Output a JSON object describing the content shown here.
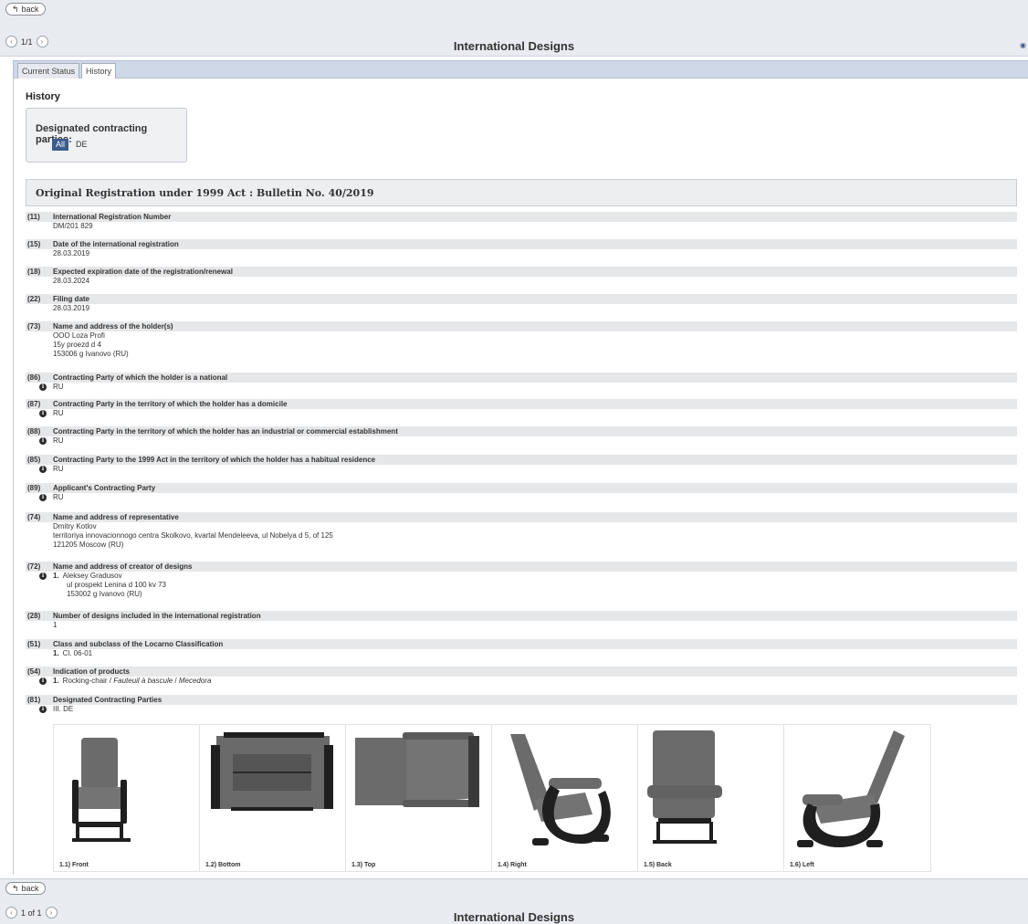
{
  "nav": {
    "back_label": "back",
    "pager_top": "1/1",
    "pager_bottom": "1 of 1",
    "title": "International Designs"
  },
  "tabs": [
    {
      "label": "Current Status",
      "active": false
    },
    {
      "label": "History",
      "active": true
    }
  ],
  "history": {
    "heading": "History",
    "filter_label": "Designated contracting parties:",
    "filter_options": [
      "All",
      "DE"
    ],
    "filter_selected": "All"
  },
  "section": {
    "title": "Original Registration under 1999 Act : Bulletin No. 40/2019"
  },
  "fields": {
    "f11": {
      "code": "(11)",
      "label": "International Registration Number",
      "lines": [
        "DM/201 829"
      ]
    },
    "f15": {
      "code": "(15)",
      "label": "Date of the international registration",
      "lines": [
        "28.03.2019"
      ]
    },
    "f18": {
      "code": "(18)",
      "label": "Expected expiration date of the registration/renewal",
      "lines": [
        "28.03.2024"
      ]
    },
    "f22": {
      "code": "(22)",
      "label": "Filing date",
      "lines": [
        "28.03.2019"
      ]
    },
    "f73": {
      "code": "(73)",
      "label": "Name and address of the holder(s)",
      "lines": [
        "OOO Loza Profi",
        "15y proezd d 4",
        "153006 g Ivanovo (RU)"
      ]
    },
    "f86": {
      "code": "(86)",
      "label": "Contracting Party of which the holder is a national",
      "lines": [
        "RU"
      ]
    },
    "f87": {
      "code": "(87)",
      "label": "Contracting Party in the territory of which the holder has a domicile",
      "lines": [
        "RU"
      ]
    },
    "f88": {
      "code": "(88)",
      "label": "Contracting Party in the territory of which the holder has an industrial or commercial establishment",
      "lines": [
        "RU"
      ]
    },
    "f85": {
      "code": "(85)",
      "label": "Contracting Party to the 1999 Act in the territory of which the holder has a habitual residence",
      "lines": [
        "RU"
      ]
    },
    "f89": {
      "code": "(89)",
      "label": "Applicant's Contracting Party",
      "lines": [
        "RU"
      ]
    },
    "f74": {
      "code": "(74)",
      "label": "Name and address of representative",
      "lines": [
        "Dmitry Kotlov",
        "territoriya innovacionnogo centra Skolkovo, kvartal Mendeleeva, ul Nobelya d 5, of 125",
        "121205 Moscow (RU)"
      ]
    },
    "f72": {
      "code": "(72)",
      "label": "Name and address of creator of designs",
      "num": "1.",
      "lines": [
        "Aleksey Gradusov",
        "ul prospekt Lenina d 100 kv 73",
        "153002 g Ivanovo (RU)"
      ]
    },
    "f28": {
      "code": "(28)",
      "label": "Number of designs included in the international registration",
      "lines": [
        "1"
      ]
    },
    "f51": {
      "code": "(51)",
      "label": "Class and subclass of the Locarno Classification",
      "num": "1.",
      "lines": [
        "Cl. 06-01"
      ]
    },
    "f54": {
      "code": "(54)",
      "label": "Indication of products",
      "num": "1.",
      "product_en": "Rocking-chair",
      "sep1": " / ",
      "product_fr": "Fauteuil à bascule",
      "sep2": " / ",
      "product_es": "Mecedora"
    },
    "f81": {
      "code": "(81)",
      "label": "Designated Contracting Parties",
      "lines": [
        "III. DE"
      ]
    }
  },
  "images": [
    {
      "caption": "1.1) Front",
      "view": "front"
    },
    {
      "caption": "1.2) Bottom",
      "view": "bottom"
    },
    {
      "caption": "1.3) Top",
      "view": "top"
    },
    {
      "caption": "1.4) Right",
      "view": "right"
    },
    {
      "caption": "1.5) Back",
      "view": "back"
    },
    {
      "caption": "1.6) Left",
      "view": "left"
    }
  ],
  "colors": {
    "accent": "#3b5d8c",
    "chair_fabric": "#6b6b6b",
    "chair_frame": "#1f1f1f"
  }
}
